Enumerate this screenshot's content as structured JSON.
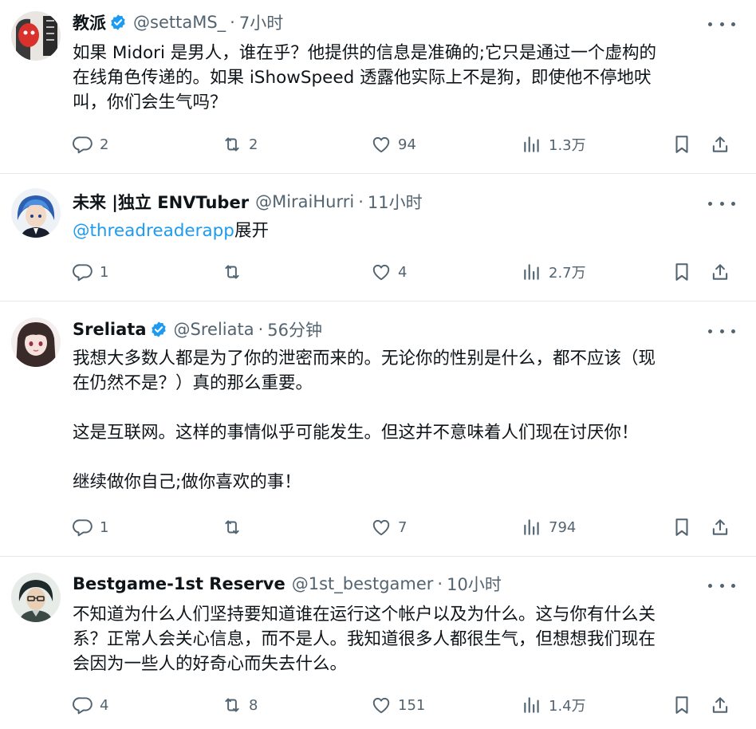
{
  "tweets": [
    {
      "name": "教派",
      "handle": "@settaMS_",
      "time": "7小时",
      "verified": true,
      "lines": [
        "如果 Midori 是男人，谁在乎？他提供的信息是准确的;它只是通过一个虚构的",
        "在线角色传递的。如果 iShowSpeed 透露他实际上不是狗，即使他不停地吠",
        "叫，你们会生气吗？"
      ],
      "replies": "2",
      "retweets": "2",
      "likes": "94",
      "views": "1.3万"
    },
    {
      "name": "未来 |独立 ENVTuber",
      "handle": "@MiraiHurri",
      "time": "11小时",
      "verified": false,
      "mention": "@threadreaderapp",
      "mention_suffix": "展开",
      "replies": "1",
      "retweets": "",
      "likes": "4",
      "views": "2.7万"
    },
    {
      "name": "Sreliata",
      "handle": "@Sreliata",
      "time": "56分钟",
      "verified": true,
      "lines": [
        "我想大多数人都是为了你的泄密而来的。无论你的性别是什么，都不应该（现",
        "在仍然不是？）真的那么重要。",
        "",
        "这是互联网。这样的事情似乎可能发生。但这并不意味着人们现在讨厌你！",
        "",
        "继续做你自己;做你喜欢的事！"
      ],
      "replies": "1",
      "retweets": "",
      "likes": "7",
      "views": "794"
    },
    {
      "name": "Bestgame-1st Reserve",
      "handle": "@1st_bestgamer",
      "time": "10小时",
      "verified": false,
      "lines": [
        "不知道为什么人们坚持要知道谁在运行这个帐户以及为什么。这与你有什么关",
        "系？正常人会关心信息，而不是人。我知道很多人都很生气，但想想我们现在",
        "会因为一些人的好奇心而失去什么。"
      ],
      "replies": "4",
      "retweets": "8",
      "likes": "151",
      "views": "1.4万"
    }
  ],
  "colors": {
    "text": "#0f1419",
    "secondary": "#536471",
    "link": "#1d9bf0",
    "verified": "#1d9bf0",
    "divider": "#e6e9ec"
  },
  "icons": [
    "reply-icon",
    "retweet-icon",
    "like-icon",
    "views-icon",
    "bookmark-icon",
    "share-icon",
    "more-icon",
    "verified-badge-icon"
  ]
}
